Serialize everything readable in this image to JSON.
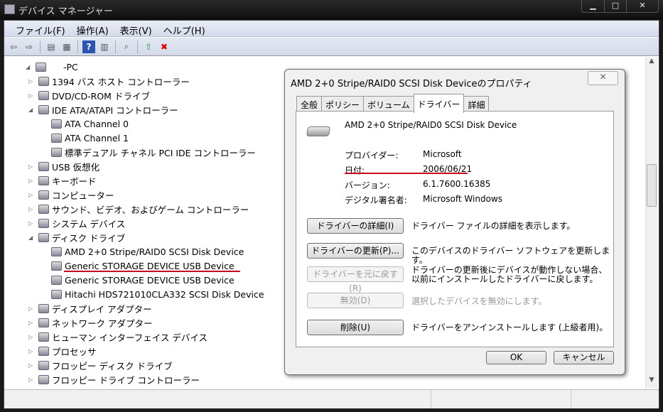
{
  "window": {
    "title": "デバイス マネージャー",
    "min": "▁",
    "max": "□",
    "close": "✕"
  },
  "menu": [
    "ファイル(F)",
    "操作(A)",
    "表示(V)",
    "ヘルプ(H)"
  ],
  "toolbar": [
    {
      "icon": "back-icon",
      "g": "⇦"
    },
    {
      "icon": "forward-icon",
      "g": "⇨"
    },
    {
      "icon": "show-hide-console-tree-icon",
      "g": "▤"
    },
    {
      "icon": "properties-icon",
      "g": "▦"
    },
    {
      "icon": "help-icon",
      "g": "?"
    },
    {
      "icon": "action-pane-icon",
      "g": "▥"
    },
    {
      "icon": "scan-hardware-icon",
      "g": "⌕"
    },
    {
      "icon": "update-driver-icon",
      "g": "⇧"
    },
    {
      "icon": "uninstall-icon",
      "g": "✖"
    }
  ],
  "tree": [
    {
      "label": "-PC",
      "level": 0,
      "state": "expanded"
    },
    {
      "label": "1394 バス ホスト コントローラー",
      "level": 1,
      "state": "collapsed"
    },
    {
      "label": "DVD/CD-ROM ドライブ",
      "level": 1,
      "state": "collapsed"
    },
    {
      "label": "IDE ATA/ATAPI コントローラー",
      "level": 1,
      "state": "expanded"
    },
    {
      "label": "ATA Channel 0",
      "level": 2
    },
    {
      "label": "ATA Channel 1",
      "level": 2
    },
    {
      "label": "標準デュアル チャネル PCI IDE コントローラー",
      "level": 2
    },
    {
      "label": "USB 仮想化",
      "level": 1,
      "state": "collapsed"
    },
    {
      "label": "キーボード",
      "level": 1,
      "state": "collapsed"
    },
    {
      "label": "コンピューター",
      "level": 1,
      "state": "collapsed"
    },
    {
      "label": "サウンド、ビデオ、およびゲーム コントローラー",
      "level": 1,
      "state": "collapsed"
    },
    {
      "label": "システム デバイス",
      "level": 1,
      "state": "collapsed"
    },
    {
      "label": "ディスク ドライブ",
      "level": 1,
      "state": "expanded"
    },
    {
      "label": "AMD 2+0 Stripe/RAID0 SCSI Disk Device",
      "level": 2
    },
    {
      "label": "Generic STORAGE DEVICE USB Device",
      "level": 2
    },
    {
      "label": "Generic STORAGE DEVICE USB Device",
      "level": 2
    },
    {
      "label": "Hitachi HDS721010CLA332 SCSI Disk Device",
      "level": 2
    },
    {
      "label": "ディスプレイ アダプター",
      "level": 1,
      "state": "collapsed"
    },
    {
      "label": "ネットワーク アダプター",
      "level": 1,
      "state": "collapsed"
    },
    {
      "label": "ヒューマン インターフェイス デバイス",
      "level": 1,
      "state": "collapsed"
    },
    {
      "label": "プロセッサ",
      "level": 1,
      "state": "collapsed"
    },
    {
      "label": "フロッピー ディスク ドライブ",
      "level": 1,
      "state": "collapsed"
    },
    {
      "label": "フロッピー ドライブ コントローラー",
      "level": 1,
      "state": "collapsed"
    }
  ],
  "dialog": {
    "title": "AMD 2+0 Stripe/RAID0 SCSI Disk Deviceのプロパティ",
    "close": "✕",
    "tabs": [
      "全般",
      "ポリシー",
      "ボリューム",
      "ドライバー",
      "詳細"
    ],
    "active_tab": 3,
    "device_name": "AMD 2+0 Stripe/RAID0 SCSI Disk Device",
    "info": [
      {
        "k": "プロバイダー:",
        "v": "Microsoft"
      },
      {
        "k": "日付:",
        "v": "2006/06/21"
      },
      {
        "k": "バージョン:",
        "v": "6.1.7600.16385"
      },
      {
        "k": "デジタル署名者:",
        "v": "Microsoft Windows"
      }
    ],
    "actions": [
      {
        "button": "ドライバーの詳細(I)",
        "desc": "ドライバー ファイルの詳細を表示します。",
        "enabled": true
      },
      {
        "button": "ドライバーの更新(P)...",
        "desc": "このデバイスのドライバー ソフトウェアを更新します。",
        "enabled": true
      },
      {
        "button": "ドライバーを元に戻す(R)",
        "desc": "ドライバーの更新後にデバイスが動作しない場合、以前にインストールしたドライバーに戻します。",
        "enabled": false
      },
      {
        "button": "無効(D)",
        "desc": "選択したデバイスを無効にします。",
        "enabled": false
      },
      {
        "button": "削除(U)",
        "desc": "ドライバーをアンインストールします (上級者用)。",
        "enabled": true
      }
    ],
    "ok": "OK",
    "cancel": "キャンセル"
  }
}
